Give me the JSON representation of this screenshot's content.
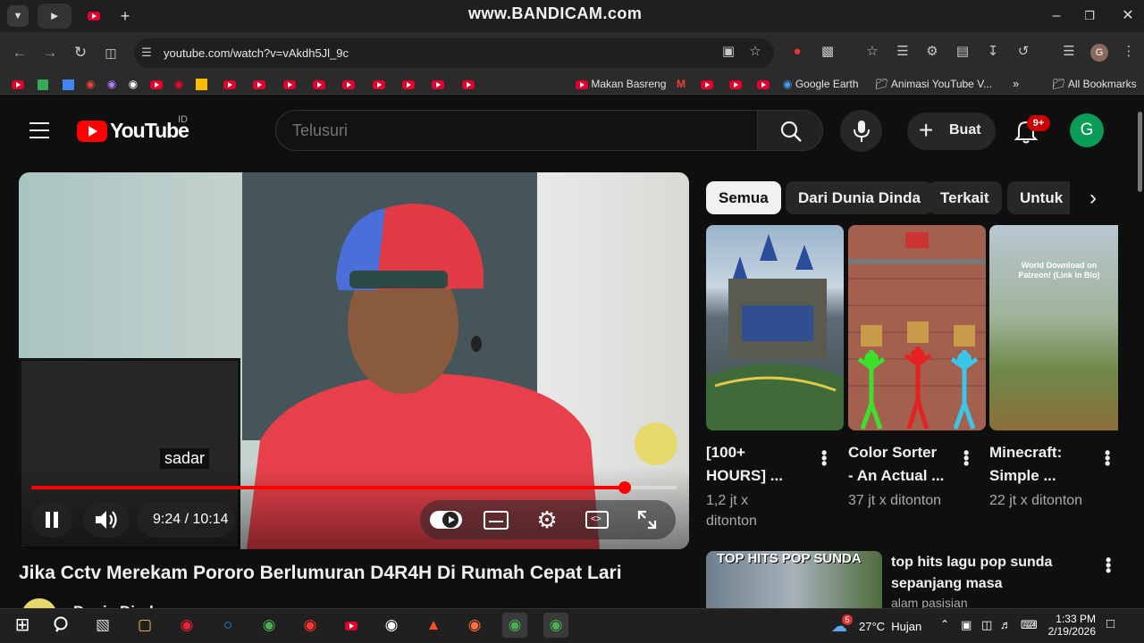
{
  "watermark": "www.BANDICAM.com",
  "browser": {
    "url": "youtube.com/watch?v=vAkdh5Jl_9c",
    "profile_initial": "G",
    "bookmarks": {
      "makan": "Makan Basreng",
      "earth": "Google Earth",
      "animasi": "Animasi YouTube V...",
      "all": "All Bookmarks"
    }
  },
  "youtube": {
    "logo_text": "YouTube",
    "logo_region": "ID",
    "search_placeholder": "Telusuri",
    "create_label": "Buat",
    "notif_badge": "9+",
    "avatar_initial": "G"
  },
  "player": {
    "subtitle": "sadar",
    "time": "9:24 / 10:14",
    "progress_fraction": 0.919
  },
  "video": {
    "title": "Jika Cctv Merekam Pororo Berlumuran D4R4H Di Rumah Cepat Lari",
    "channel": "Dunia Dinda"
  },
  "chips": [
    "Semua",
    "Dari Dunia Dinda",
    "Terkait",
    "Untuk"
  ],
  "recommendations": [
    {
      "title_l1": "[100+",
      "title_l2": "HOURS] ...",
      "meta_l1": "1,2 jt x",
      "meta_l2": "ditonton"
    },
    {
      "title_l1": "Color Sorter",
      "title_l2": "- An Actual ...",
      "meta_l1": "37 jt x ditonton",
      "meta_l2": ""
    },
    {
      "title_l1": "Minecraft:",
      "title_l2": "Simple ...",
      "meta_l1": "22 jt x ditonton",
      "meta_l2": ""
    }
  ],
  "thumb_text_3": "World Download on Patreon! (Link in Bio)",
  "list_item": {
    "thumb_text": "TOP HITS POP SUNDA",
    "title_l1": "top hits lagu pop sunda",
    "title_l2": "sepanjang masa",
    "channel": "alam pasisian"
  },
  "taskbar": {
    "weather": "27°C  Hujan",
    "weather_badge": "5",
    "time": "1:33 PM",
    "date": "2/19/2026"
  }
}
